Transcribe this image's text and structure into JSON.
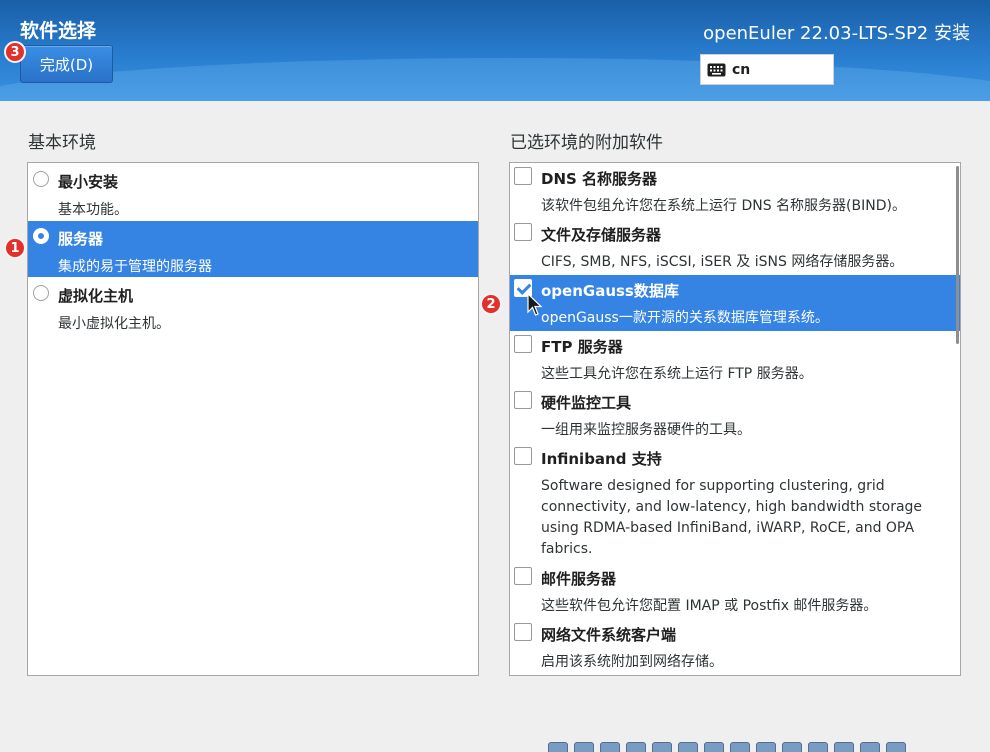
{
  "header": {
    "page_title": "软件选择",
    "done_button": "完成(D)",
    "product_title": "openEuler 22.03-LTS-SP2 安装",
    "keyboard_layout": "cn"
  },
  "badges": [
    "1",
    "2",
    "3"
  ],
  "base_environment": {
    "heading": "基本环境",
    "items": [
      {
        "title": "最小安装",
        "desc": "基本功能。",
        "selected": false
      },
      {
        "title": "服务器",
        "desc": "集成的易于管理的服务器",
        "selected": true
      },
      {
        "title": "虚拟化主机",
        "desc": "最小虚拟化主机。",
        "selected": false
      }
    ]
  },
  "addons": {
    "heading": "已选环境的附加软件",
    "items": [
      {
        "title": "DNS 名称服务器",
        "desc": "该软件包组允许您在系统上运行 DNS 名称服务器(BIND)。",
        "checked": false
      },
      {
        "title": "文件及存储服务器",
        "desc": "CIFS, SMB, NFS, iSCSI, iSER 及 iSNS 网络存储服务器。",
        "checked": false
      },
      {
        "title": "openGauss数据库",
        "desc": "openGauss一款开源的关系数据库管理系统。",
        "checked": true
      },
      {
        "title": "FTP 服务器",
        "desc": "这些工具允许您在系统上运行 FTP 服务器。",
        "checked": false
      },
      {
        "title": "硬件监控工具",
        "desc": "一组用来监控服务器硬件的工具。",
        "checked": false
      },
      {
        "title": "Infiniband 支持",
        "desc": "Software designed for supporting clustering, grid connectivity, and low-latency, high bandwidth storage using RDMA-based InfiniBand, iWARP, RoCE, and OPA fabrics.",
        "checked": false
      },
      {
        "title": "邮件服务器",
        "desc": "这些软件包允许您配置 IMAP 或 Postfix 邮件服务器。",
        "checked": false
      },
      {
        "title": "网络文件系统客户端",
        "desc": "启用该系统附加到网络存储。",
        "checked": false
      }
    ]
  },
  "colors": {
    "accent": "#3584e4",
    "header": "#2a7fd1",
    "badge": "#e2312b"
  }
}
